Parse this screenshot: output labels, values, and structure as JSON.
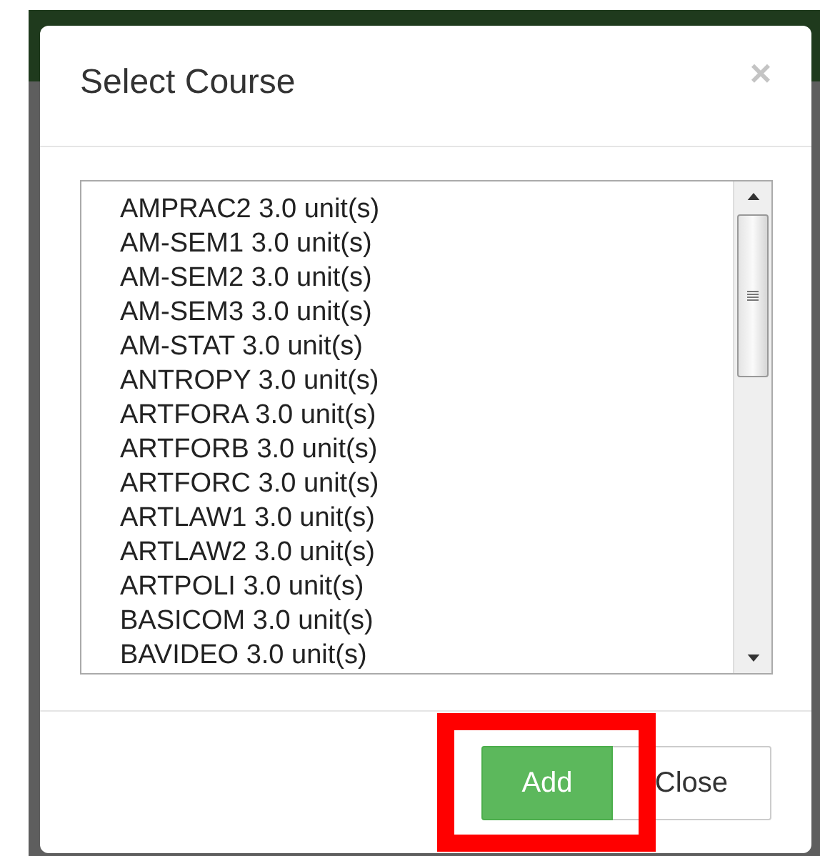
{
  "dialog": {
    "title": "Select Course",
    "close_symbol": "×"
  },
  "course_list": {
    "items": [
      {
        "label": "AMPRAC2 3.0 unit(s)",
        "selected": false
      },
      {
        "label": "AM-SEM1 3.0 unit(s)",
        "selected": false
      },
      {
        "label": "AM-SEM2 3.0 unit(s)",
        "selected": false
      },
      {
        "label": "AM-SEM3 3.0 unit(s)",
        "selected": false
      },
      {
        "label": "AM-STAT 3.0 unit(s)",
        "selected": false
      },
      {
        "label": "ANTROPY 3.0 unit(s)",
        "selected": false
      },
      {
        "label": "ARTFORA 3.0 unit(s)",
        "selected": false
      },
      {
        "label": "ARTFORB 3.0 unit(s)",
        "selected": false
      },
      {
        "label": "ARTFORC 3.0 unit(s)",
        "selected": false
      },
      {
        "label": "ARTLAW1 3.0 unit(s)",
        "selected": false
      },
      {
        "label": "ARTLAW2 3.0 unit(s)",
        "selected": false
      },
      {
        "label": "ARTPOLI 3.0 unit(s)",
        "selected": false
      },
      {
        "label": "BASICOM 3.0 unit(s)",
        "selected": false
      },
      {
        "label": "BAVIDEO 3.0 unit(s)",
        "selected": false
      }
    ]
  },
  "buttons": [
    {
      "label": "Add",
      "kind": "primary"
    },
    {
      "label": "Close",
      "kind": "default"
    }
  ]
}
